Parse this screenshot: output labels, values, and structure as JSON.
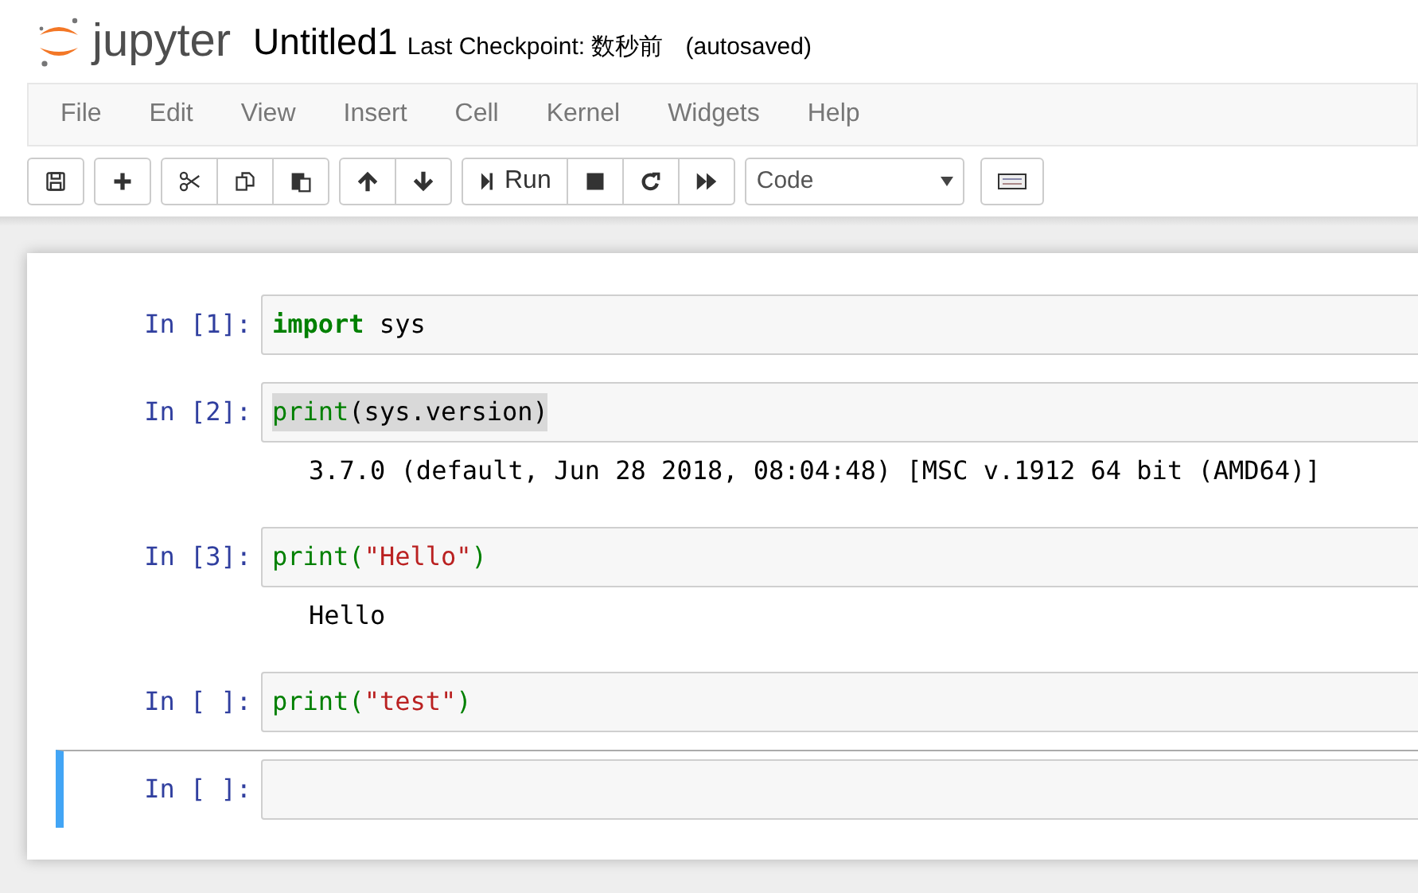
{
  "header": {
    "logo_text": "jupyter",
    "notebook_name": "Untitled1",
    "checkpoint": "Last Checkpoint: 数秒前",
    "autosave": "(autosaved)"
  },
  "menu": [
    "File",
    "Edit",
    "View",
    "Insert",
    "Cell",
    "Kernel",
    "Widgets",
    "Help"
  ],
  "toolbar": {
    "groups": [
      [
        {
          "kind": "save"
        }
      ],
      [
        {
          "kind": "plus"
        }
      ],
      [
        {
          "kind": "cut"
        },
        {
          "kind": "copy"
        },
        {
          "kind": "paste"
        }
      ],
      [
        {
          "kind": "up"
        },
        {
          "kind": "down"
        }
      ],
      [
        {
          "kind": "run",
          "label": "Run"
        },
        {
          "kind": "stop"
        },
        {
          "kind": "restart"
        },
        {
          "kind": "fastforward"
        }
      ]
    ],
    "cell_type": "Code"
  },
  "cells": [
    {
      "prompt": "In [1]:",
      "selected": false,
      "code": [
        {
          "kind": "keyword",
          "text": "import"
        },
        {
          "kind": "plain",
          "text": " sys"
        }
      ]
    },
    {
      "prompt": "In [2]:",
      "selected": false,
      "highlighted": true,
      "code": [
        {
          "kind": "builtin",
          "text": "print"
        },
        {
          "kind": "plain",
          "text": "(sys.version)"
        }
      ],
      "output": "3.7.0 (default, Jun 28 2018, 08:04:48) [MSC v.1912 64 bit (AMD64)]"
    },
    {
      "prompt": "In [3]:",
      "selected": false,
      "code": [
        {
          "kind": "builtin",
          "text": "print"
        },
        {
          "kind": "builtin",
          "text": "("
        },
        {
          "kind": "string",
          "text": "\"Hello\""
        },
        {
          "kind": "builtin",
          "text": ")"
        }
      ],
      "output": "Hello"
    },
    {
      "prompt": "In [ ]:",
      "selected": false,
      "code": [
        {
          "kind": "builtin",
          "text": "print"
        },
        {
          "kind": "builtin",
          "text": "("
        },
        {
          "kind": "string",
          "text": "\"test\""
        },
        {
          "kind": "builtin",
          "text": ")"
        }
      ]
    },
    {
      "prompt": "In [ ]:",
      "selected": true
    }
  ]
}
